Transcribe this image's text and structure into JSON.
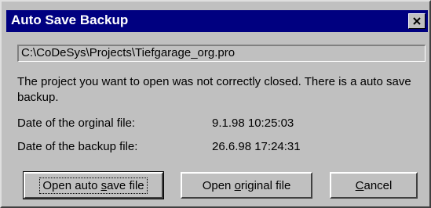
{
  "window": {
    "title": "Auto Save Backup",
    "close_label": "×"
  },
  "dialog": {
    "path": "C:\\CoDeSys\\Projects\\Tiefgarage_org.pro",
    "message": "The project you want to open was not correctly closed. There is a auto save backup.",
    "original_label": "Date of the orginal file:",
    "original_value": "9.1.98 10:25:03",
    "backup_label": "Date of the backup file:",
    "backup_value": "26.6.98 17:24:31"
  },
  "buttons": {
    "open_auto_pre": "Open auto ",
    "open_auto_accel": "s",
    "open_auto_post": "ave file",
    "open_orig_pre": "Open ",
    "open_orig_accel": "o",
    "open_orig_post": "riginal file",
    "cancel_accel": "C",
    "cancel_post": "ancel"
  }
}
